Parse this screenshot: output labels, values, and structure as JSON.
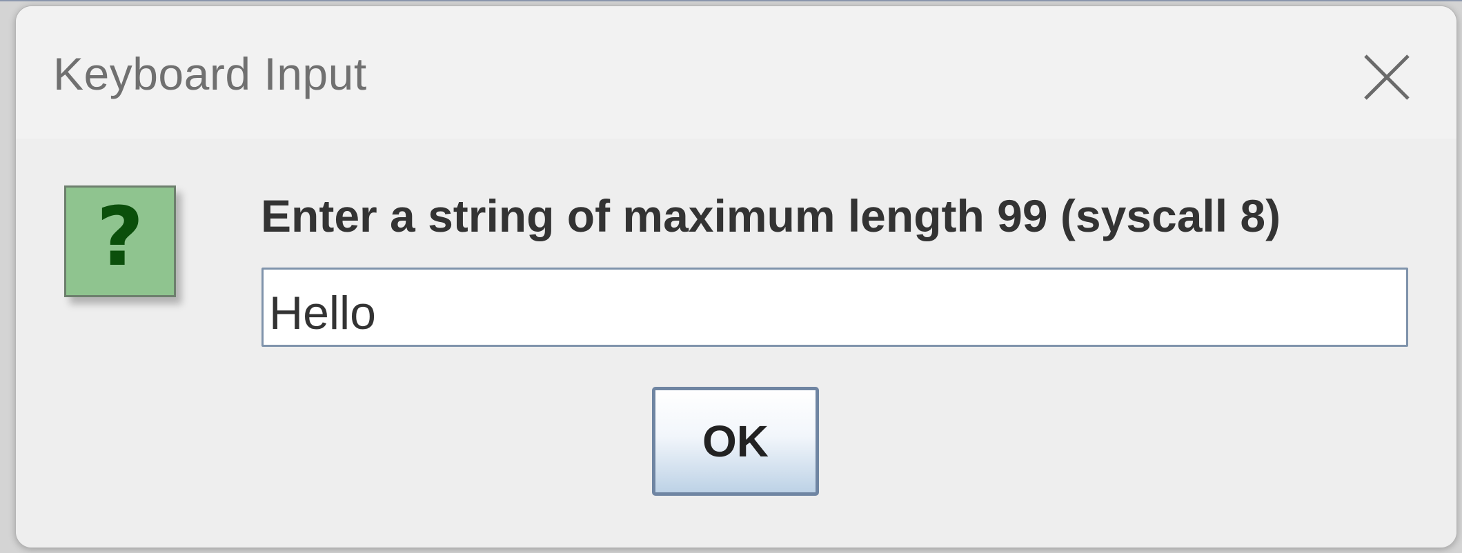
{
  "dialog": {
    "title": "Keyboard Input",
    "prompt": "Enter a string of maximum length 99 (syscall 8)",
    "input_value": "Hello",
    "ok_label": "OK",
    "icon": "question-icon",
    "icon_glyph": "?",
    "close_icon": "close-icon"
  },
  "colors": {
    "icon_background": "#8fc48f",
    "icon_glyph": "#0b4f0b",
    "button_border": "#6f85a2"
  }
}
